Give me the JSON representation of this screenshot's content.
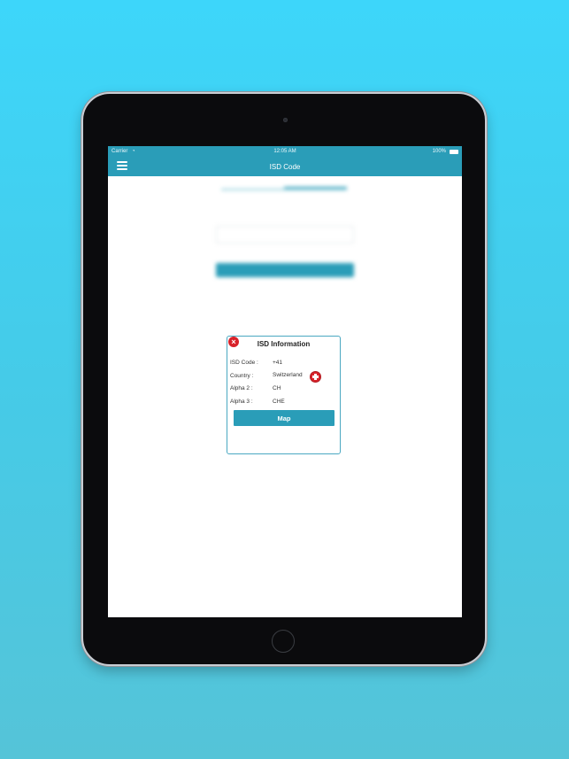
{
  "status_bar": {
    "carrier": "Carrier",
    "wifi_icon": "wifi-icon",
    "time": "12:05 AM",
    "battery": "100%"
  },
  "nav": {
    "menu_icon": "hamburger-menu-icon",
    "title": "ISD Code"
  },
  "popup": {
    "title": "ISD Information",
    "close_icon": "close-icon",
    "rows": [
      {
        "label": "ISD Code :",
        "value": "+41"
      },
      {
        "label": "Country :",
        "value": "Switzerland"
      },
      {
        "label": "Alpha 2 :",
        "value": "CH"
      },
      {
        "label": "Alpha 3 :",
        "value": "CHE"
      }
    ],
    "flag_icon": "switzerland-flag-icon",
    "map_button": "Map"
  },
  "colors": {
    "background_top": "#3dd6fa",
    "background_bottom": "#55c4d8",
    "accent": "#2a9db8",
    "close": "#d8222a"
  }
}
